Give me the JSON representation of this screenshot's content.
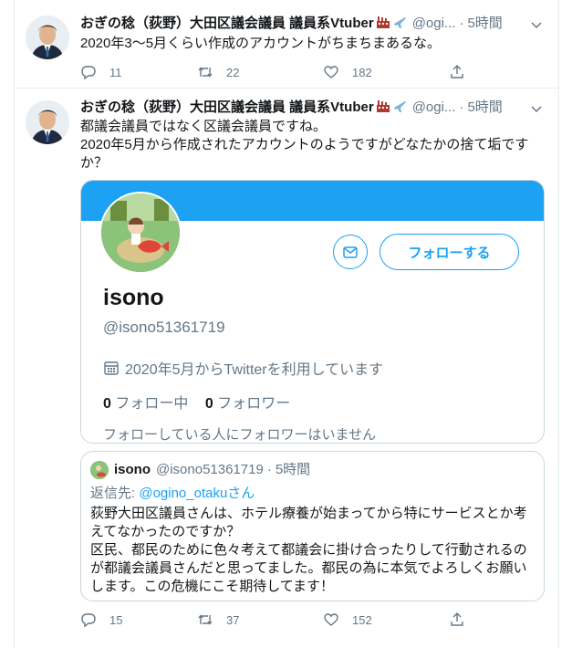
{
  "tweets": [
    {
      "author": {
        "name": "おぎの稔（荻野）大田区議会議員 議員系Vtuber",
        "handle": "@ogi...",
        "time": "5時間"
      },
      "text": "2020年3〜5月くらい作成のアカウントがちまちまあるな。",
      "stats": {
        "replies": "11",
        "retweets": "22",
        "likes": "182"
      }
    },
    {
      "author": {
        "name": "おぎの稔（荻野）大田区議会議員 議員系Vtuber",
        "handle": "@ogi...",
        "time": "5時間"
      },
      "text_lines": [
        "都議会議員ではなく区議会議員ですね。",
        "2020年5月から作成されたアカウントのようですがどなたかの捨て垢です",
        "か？"
      ],
      "profile_card": {
        "name": "isono",
        "handle": "@isono51361719",
        "joined": "2020年5月からTwitterを利用しています",
        "following_count": "0",
        "following_label": "フォロー中",
        "followers_count": "0",
        "followers_label": "フォロワー",
        "no_followers_text": "フォローしている人にフォロワーはいません",
        "follow_button": "フォローする",
        "accent_color": "#1da1f2"
      },
      "quoted": {
        "name": "isono",
        "handle": "@isono51361719",
        "time": "5時間",
        "reply_prefix": "返信先:",
        "reply_to": "@ogino_otakuさん",
        "text_lines": [
          "荻野大田区議員さんは、ホテル療養が始まってから特にサービスとか考",
          "えてなかったのですか？",
          "区民、都民のために色々考えて都議会に掛け合ったりして行動されるの",
          "が都議会議員さんだと思ってました。都民の為に本気でよろしくお願い",
          "します。この危機にこそ期待してます！"
        ]
      },
      "stats": {
        "replies": "15",
        "retweets": "37",
        "likes": "152"
      }
    }
  ],
  "icons": [
    "caret-down-icon",
    "reply-icon",
    "retweet-icon",
    "like-icon",
    "share-icon",
    "mail-icon",
    "calendar-icon",
    "factory-emoji",
    "airplane-emoji"
  ]
}
